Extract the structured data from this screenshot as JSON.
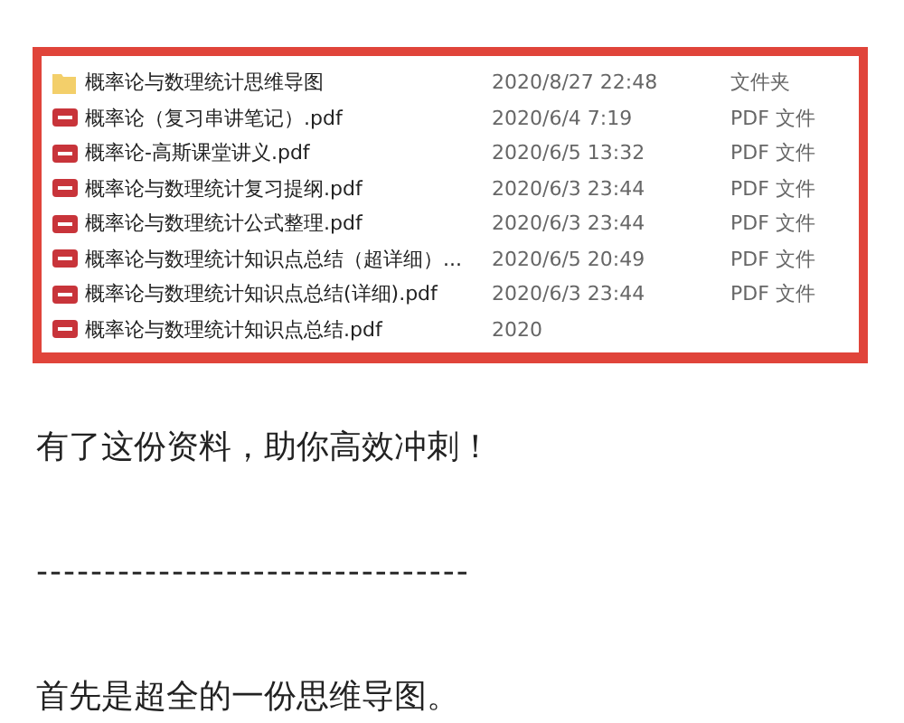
{
  "files": [
    {
      "kind": "folder",
      "name": "概率论与数理统计思维导图",
      "modified": "2020/8/27 22:48",
      "type": "文件夹"
    },
    {
      "kind": "pdf",
      "name": "概率论（复习串讲笔记）.pdf",
      "modified": "2020/6/4 7:19",
      "type": "PDF 文件"
    },
    {
      "kind": "pdf",
      "name": "概率论-高斯课堂讲义.pdf",
      "modified": "2020/6/5 13:32",
      "type": "PDF 文件"
    },
    {
      "kind": "pdf",
      "name": "概率论与数理统计复习提纲.pdf",
      "modified": "2020/6/3 23:44",
      "type": "PDF 文件"
    },
    {
      "kind": "pdf",
      "name": "概率论与数理统计公式整理.pdf",
      "modified": "2020/6/3 23:44",
      "type": "PDF 文件"
    },
    {
      "kind": "pdf",
      "name": "概率论与数理统计知识点总结（超详细）...",
      "modified": "2020/6/5 20:49",
      "type": "PDF 文件"
    },
    {
      "kind": "pdf",
      "name": "概率论与数理统计知识点总结(详细).pdf",
      "modified": "2020/6/3 23:44",
      "type": "PDF 文件"
    },
    {
      "kind": "pdf",
      "name": "概率论与数理统计知识点总结.pdf",
      "modified": "2020"
    }
  ],
  "paragraphs": [
    "有了这份资料，助你高效冲刺！",
    "--------------------------------",
    "首先是超全的一份思维导图。"
  ]
}
